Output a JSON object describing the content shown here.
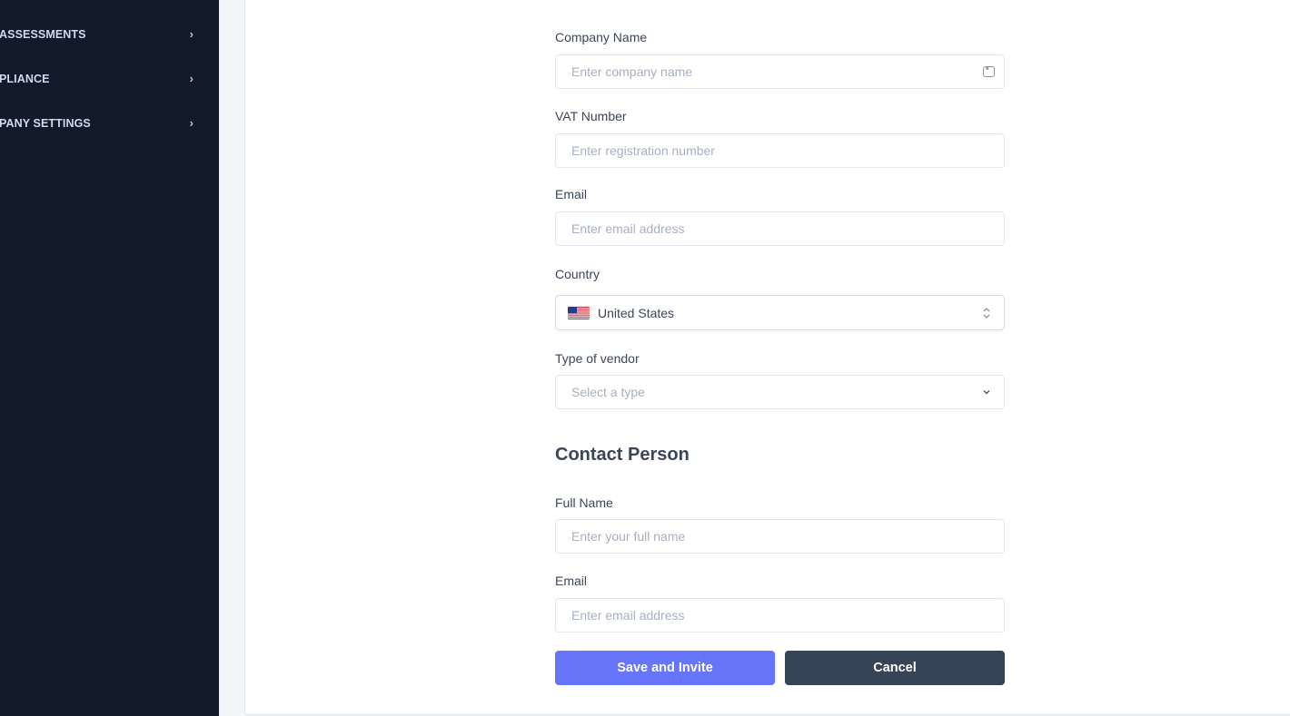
{
  "sidebar": {
    "items": [
      {
        "label": "ASSESSMENTS",
        "chevron": "›"
      },
      {
        "label": "PLIANCE",
        "chevron": "›"
      },
      {
        "label": "PANY SETTINGS",
        "chevron": "›"
      }
    ]
  },
  "form": {
    "company_name": {
      "label": "Company Name",
      "placeholder": "Enter company name"
    },
    "vat_number": {
      "label": "VAT Number",
      "placeholder": "Enter registration number"
    },
    "email": {
      "label": "Email",
      "placeholder": "Enter email address"
    },
    "country": {
      "label": "Country",
      "value": "United States"
    },
    "vendor_type": {
      "label": "Type of vendor",
      "placeholder": "Select a type"
    }
  },
  "contact": {
    "title": "Contact Person",
    "full_name": {
      "label": "Full Name",
      "placeholder": "Enter your full name"
    },
    "email": {
      "label": "Email",
      "placeholder": "Enter email address"
    }
  },
  "actions": {
    "save_label": "Save and Invite",
    "cancel_label": "Cancel"
  },
  "colors": {
    "sidebar_bg": "#121a2a",
    "primary": "#6675fa",
    "secondary": "#374457"
  },
  "icons": {
    "company_field": "id-card-icon",
    "country_select": "up-down-chevrons-icon",
    "type_select": "chevron-down-icon",
    "country_flag": "us-flag-icon"
  }
}
